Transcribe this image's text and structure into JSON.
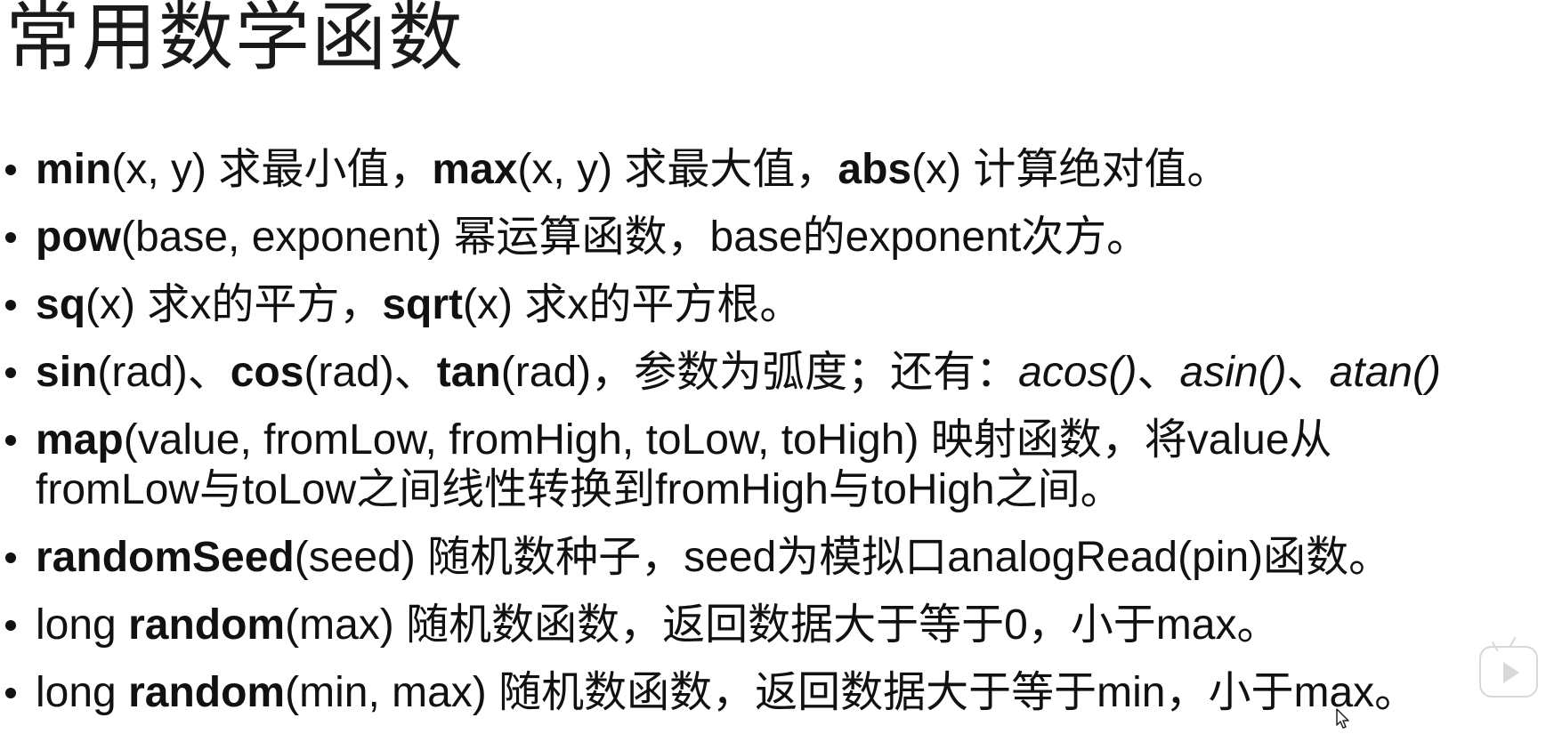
{
  "title": "常用数学函数",
  "bullets": [
    {
      "lines": [
        [
          {
            "t": "min",
            "s": "b"
          },
          {
            "t": "(x, y) 求最小值，",
            "s": "n"
          },
          {
            "t": "max",
            "s": "b"
          },
          {
            "t": "(x, y) 求最大值，",
            "s": "n"
          },
          {
            "t": "abs",
            "s": "b"
          },
          {
            "t": "(x)  计算绝对值。",
            "s": "n"
          }
        ]
      ]
    },
    {
      "lines": [
        [
          {
            "t": "pow",
            "s": "b"
          },
          {
            "t": "(base, exponent)  幂运算函数，base的exponent次方。",
            "s": "n"
          }
        ]
      ]
    },
    {
      "lines": [
        [
          {
            "t": "sq",
            "s": "b"
          },
          {
            "t": "(x)  求x的平方，",
            "s": "n"
          },
          {
            "t": "sqrt",
            "s": "b"
          },
          {
            "t": "(x)   求x的平方根。",
            "s": "n"
          }
        ]
      ]
    },
    {
      "lines": [
        [
          {
            "t": "sin",
            "s": "b"
          },
          {
            "t": "(rad)、",
            "s": "n"
          },
          {
            "t": "cos",
            "s": "b"
          },
          {
            "t": "(rad)、",
            "s": "n"
          },
          {
            "t": "tan",
            "s": "b"
          },
          {
            "t": "(rad)，参数为弧度；还有：",
            "s": "n"
          },
          {
            "t": "acos()",
            "s": "i"
          },
          {
            "t": "、",
            "s": "n"
          },
          {
            "t": "asin()",
            "s": "i"
          },
          {
            "t": "、",
            "s": "n"
          },
          {
            "t": "atan()",
            "s": "i"
          }
        ]
      ]
    },
    {
      "lines": [
        [
          {
            "t": "map",
            "s": "b"
          },
          {
            "t": "(value, fromLow, fromHigh, toLow, toHigh)    映射函数，将value从",
            "s": "n"
          }
        ],
        [
          {
            "t": "fromLow与toLow之间线性转换到fromHigh与toHigh之间。",
            "s": "n"
          }
        ]
      ]
    },
    {
      "lines": [
        [
          {
            "t": "randomSeed",
            "s": "b"
          },
          {
            "t": "(seed)   随机数种子，seed为模拟口analogRead(pin)函数。",
            "s": "n"
          }
        ]
      ]
    },
    {
      "lines": [
        [
          {
            "t": "long ",
            "s": "n"
          },
          {
            "t": "random",
            "s": "b"
          },
          {
            "t": "(max)   随机数函数，返回数据大于等于0，小于max。",
            "s": "n"
          }
        ]
      ]
    },
    {
      "lines": [
        [
          {
            "t": "long ",
            "s": "n"
          },
          {
            "t": "random",
            "s": "b"
          },
          {
            "t": "(min, max)   随机数函数，返回数据大于等于min，小于max。",
            "s": "n"
          }
        ]
      ]
    }
  ],
  "icons": {
    "play_badge": "video-play-icon",
    "cursor": "mouse-cursor-icon"
  }
}
